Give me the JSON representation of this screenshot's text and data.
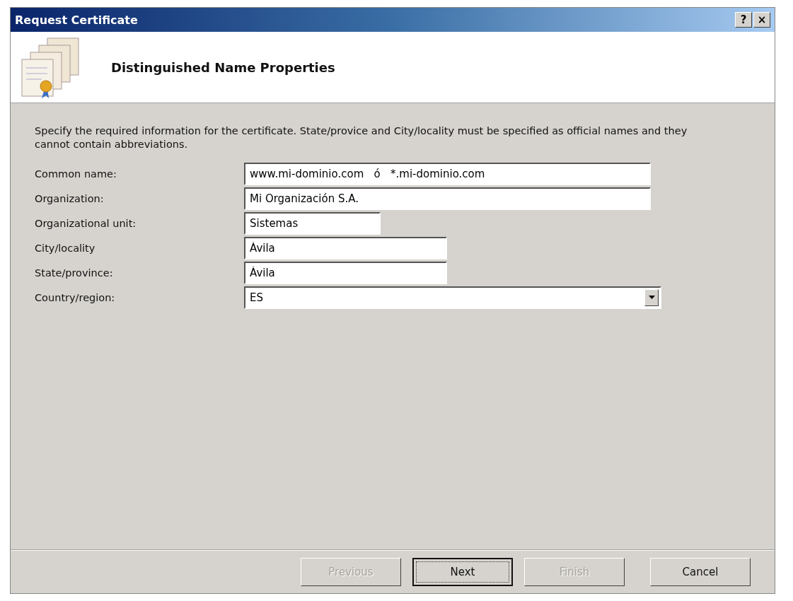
{
  "window": {
    "title": "Request Certificate",
    "controls": [
      "?",
      "×"
    ]
  },
  "header": {
    "title": "Distinguished Name Properties"
  },
  "instructions": "Specify the required information for the certificate. State/provice and City/locality must be specified as official names and they cannot contain abbreviations.",
  "fields": [
    {
      "label": "Common name:",
      "kind": "text",
      "value": "www.mi-dominio.com   ó   *.mi-dominio.com"
    },
    {
      "label": "Organization:",
      "kind": "text",
      "value": "Mi Organización S.A."
    },
    {
      "label": "Organizational unit:",
      "kind": "text",
      "value": "Sistemas"
    },
    {
      "label": "City/locality",
      "kind": "text",
      "value": "Ávila"
    },
    {
      "label": "State/province:",
      "kind": "text",
      "value": "Ávila"
    },
    {
      "label": "Country/region:",
      "kind": "dropdown",
      "value": "ES"
    }
  ],
  "buttons": [
    {
      "label": "Previous",
      "disabled": true,
      "focused": false
    },
    {
      "label": "Next",
      "disabled": false,
      "focused": true
    },
    {
      "label": "Finish",
      "disabled": true,
      "focused": false
    },
    {
      "label": "Cancel",
      "disabled": false,
      "focused": false
    }
  ]
}
